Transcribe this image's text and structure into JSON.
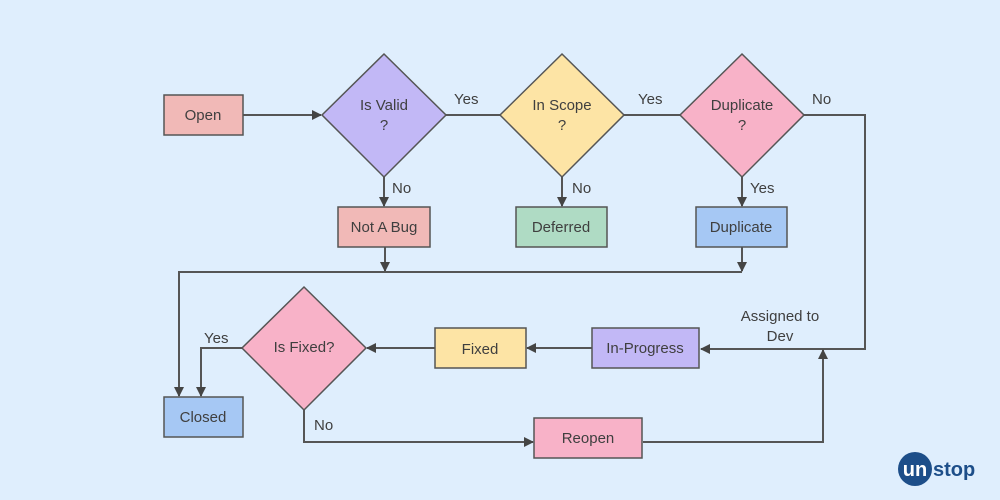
{
  "colors": {
    "background": "#dfeefd",
    "red": "#f1b9b7",
    "purple": "#c2b8f6",
    "yellow": "#fde4a5",
    "pink": "#f8b2c8",
    "green": "#afdbc4",
    "blue": "#a6c8f4",
    "line": "#555555",
    "logo": "#1d4e89"
  },
  "nodes": {
    "open": "Open",
    "is_valid": [
      "Is Valid",
      "?"
    ],
    "in_scope": [
      "In Scope",
      "?"
    ],
    "duplicate_q": [
      "Duplicate",
      "?"
    ],
    "not_a_bug": "Not A Bug",
    "deferred": "Deferred",
    "duplicate": "Duplicate",
    "in_progress": "In-Progress",
    "fixed": "Fixed",
    "is_fixed": "Is Fixed?",
    "closed": "Closed",
    "reopen": "Reopen"
  },
  "edge_labels": {
    "valid_yes": "Yes",
    "valid_no": "No",
    "scope_yes": "Yes",
    "scope_no": "No",
    "dup_no": "No",
    "dup_yes": "Yes",
    "assigned": [
      "Assigned to",
      "Dev"
    ],
    "fixed_yes": "Yes",
    "fixed_no": "No"
  },
  "logo": {
    "text_a": "un",
    "text_b": "stop"
  }
}
